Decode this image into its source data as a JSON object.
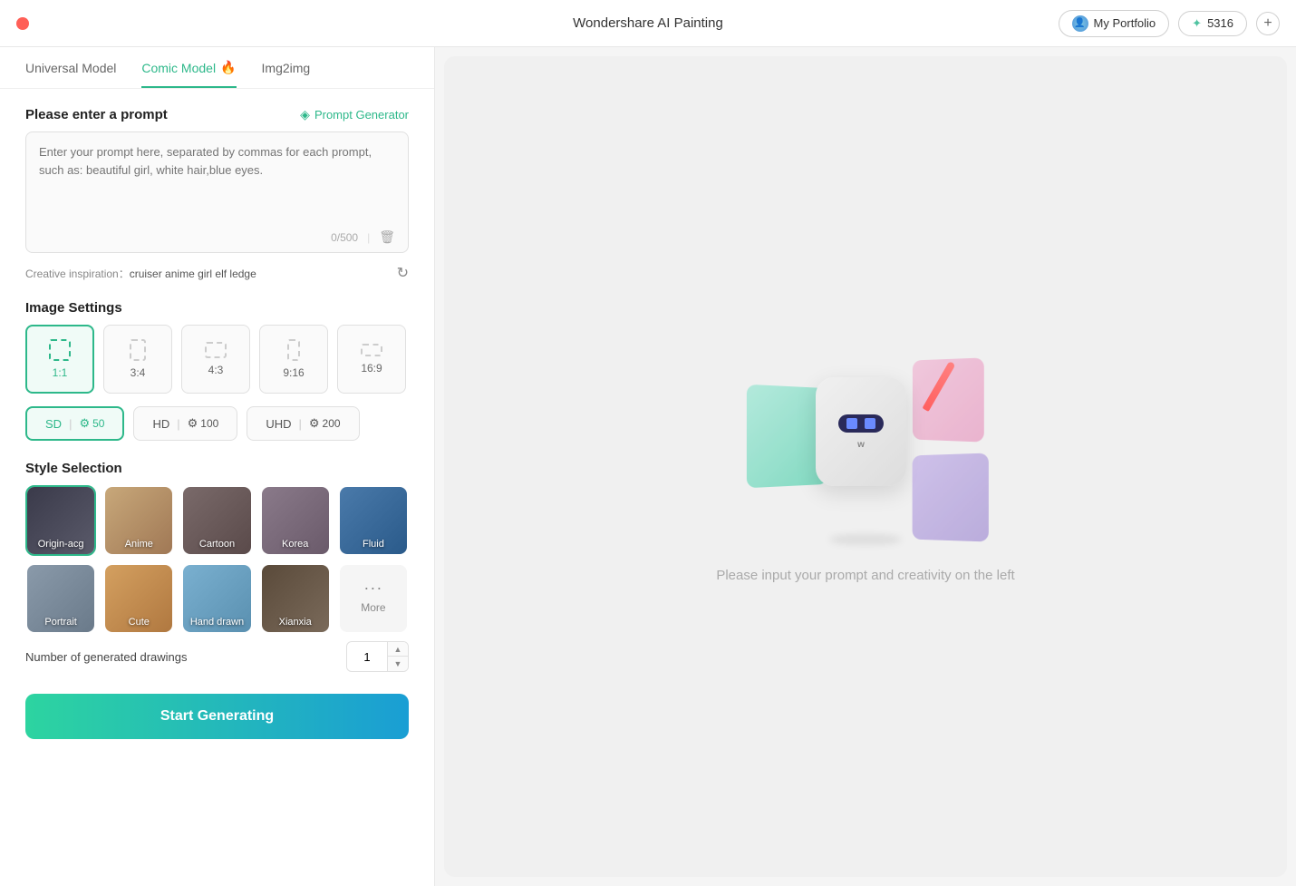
{
  "titlebar": {
    "title": "Wondershare AI Painting",
    "portfolio_label": "My Portfolio",
    "credits_amount": "5316",
    "add_label": "+"
  },
  "tabs": [
    {
      "id": "universal",
      "label": "Universal Model",
      "active": false
    },
    {
      "id": "comic",
      "label": "Comic Model",
      "active": true,
      "badge": "🔥"
    },
    {
      "id": "img2img",
      "label": "Img2img",
      "active": false
    }
  ],
  "prompt": {
    "section_title": "Please enter a prompt",
    "prompt_gen_label": "Prompt Generator",
    "placeholder": "Enter your prompt here, separated by commas for each prompt, such as: beautiful girl, white hair,blue eyes.",
    "char_count": "0/500",
    "inspiration_label": "Creative inspiration：",
    "inspiration_tags": "cruiser   anime girl   elf ledge"
  },
  "image_settings": {
    "section_title": "Image Settings",
    "aspect_ratios": [
      {
        "id": "1:1",
        "label": "1:1",
        "active": true
      },
      {
        "id": "3:4",
        "label": "3:4",
        "active": false
      },
      {
        "id": "4:3",
        "label": "4:3",
        "active": false
      },
      {
        "id": "9:16",
        "label": "9:16",
        "active": false
      },
      {
        "id": "16:9",
        "label": "16:9",
        "active": false
      }
    ],
    "quality_options": [
      {
        "id": "sd",
        "label": "SD",
        "coins": "50",
        "active": true
      },
      {
        "id": "hd",
        "label": "HD",
        "coins": "100",
        "active": false
      },
      {
        "id": "uhd",
        "label": "UHD",
        "coins": "200",
        "active": false
      }
    ]
  },
  "style_selection": {
    "section_title": "Style Selection",
    "styles": [
      {
        "id": "origin-acg",
        "label": "Origin-acg",
        "active": true,
        "color_class": "style-origin-acg"
      },
      {
        "id": "anime",
        "label": "Anime",
        "active": false,
        "color_class": "style-anime"
      },
      {
        "id": "cartoon",
        "label": "Cartoon",
        "active": false,
        "color_class": "style-cartoon"
      },
      {
        "id": "korea",
        "label": "Korea",
        "active": false,
        "color_class": "style-korea"
      },
      {
        "id": "fluid",
        "label": "Fluid",
        "active": false,
        "color_class": "style-fluid"
      },
      {
        "id": "portrait",
        "label": "Portrait",
        "active": false,
        "color_class": "style-portrait"
      },
      {
        "id": "cute",
        "label": "Cute",
        "active": false,
        "color_class": "style-cute"
      },
      {
        "id": "hand-drawn",
        "label": "Hand drawn",
        "active": false,
        "color_class": "style-hand-drawn"
      },
      {
        "id": "xianxia",
        "label": "Xianxia",
        "active": false,
        "color_class": "style-xianxia"
      },
      {
        "id": "more",
        "label": "More",
        "active": false,
        "color_class": "style-more"
      }
    ]
  },
  "generation": {
    "number_label": "Number of generated drawings",
    "number_value": "1",
    "start_label": "Start Generating"
  },
  "right_panel": {
    "placeholder_text": "Please input your prompt and creativity on the left"
  }
}
